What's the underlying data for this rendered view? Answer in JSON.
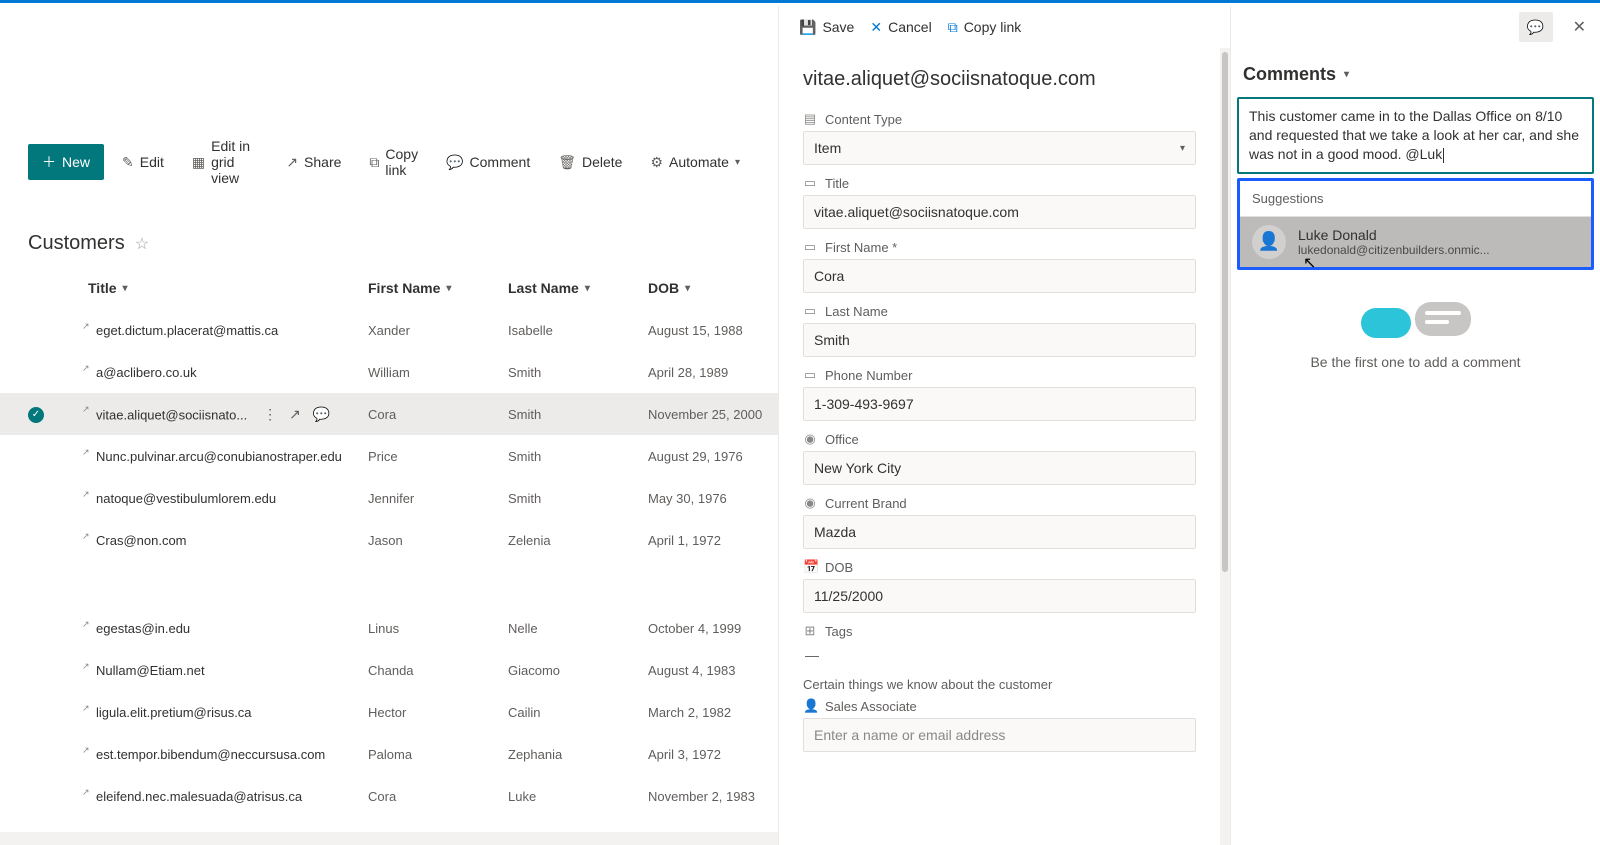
{
  "cmdbar": {
    "new_label": "New",
    "edit_label": "Edit",
    "edit_grid_label": "Edit in grid view",
    "share_label": "Share",
    "copy_link_label": "Copy link",
    "comment_label": "Comment",
    "delete_label": "Delete",
    "automate_label": "Automate"
  },
  "list": {
    "title": "Customers",
    "columns": {
      "title": "Title",
      "first_name": "First Name",
      "last_name": "Last Name",
      "dob": "DOB"
    }
  },
  "rows": [
    {
      "title": "eget.dictum.placerat@mattis.ca",
      "first": "Xander",
      "last": "Isabelle",
      "dob": "August 15, 1988"
    },
    {
      "title": "a@aclibero.co.uk",
      "first": "William",
      "last": "Smith",
      "dob": "April 28, 1989"
    },
    {
      "title": "vitae.aliquet@sociisnato...",
      "first": "Cora",
      "last": "Smith",
      "dob": "November 25, 2000",
      "selected": true
    },
    {
      "title": "Nunc.pulvinar.arcu@conubianostraper.edu",
      "first": "Price",
      "last": "Smith",
      "dob": "August 29, 1976"
    },
    {
      "title": "natoque@vestibulumlorem.edu",
      "first": "Jennifer",
      "last": "Smith",
      "dob": "May 30, 1976"
    },
    {
      "title": "Cras@non.com",
      "first": "Jason",
      "last": "Zelenia",
      "dob": "April 1, 1972"
    },
    {
      "title": "egestas@in.edu",
      "first": "Linus",
      "last": "Nelle",
      "dob": "October 4, 1999"
    },
    {
      "title": "Nullam@Etiam.net",
      "first": "Chanda",
      "last": "Giacomo",
      "dob": "August 4, 1983"
    },
    {
      "title": "ligula.elit.pretium@risus.ca",
      "first": "Hector",
      "last": "Cailin",
      "dob": "March 2, 1982"
    },
    {
      "title": "est.tempor.bibendum@neccursusa.com",
      "first": "Paloma",
      "last": "Zephania",
      "dob": "April 3, 1972"
    },
    {
      "title": "eleifend.nec.malesuada@atrisus.ca",
      "first": "Cora",
      "last": "Luke",
      "dob": "November 2, 1983"
    }
  ],
  "panel": {
    "save_label": "Save",
    "cancel_label": "Cancel",
    "copy_link_label": "Copy link",
    "item_title": "vitae.aliquet@sociisnatoque.com",
    "fields": {
      "content_type": {
        "label": "Content Type",
        "value": "Item"
      },
      "title": {
        "label": "Title",
        "value": "vitae.aliquet@sociisnatoque.com"
      },
      "first_name": {
        "label": "First Name *",
        "value": "Cora"
      },
      "last_name": {
        "label": "Last Name",
        "value": "Smith"
      },
      "phone": {
        "label": "Phone Number",
        "value": "1-309-493-9697"
      },
      "office": {
        "label": "Office",
        "value": "New York City"
      },
      "brand": {
        "label": "Current Brand",
        "value": "Mazda"
      },
      "dob": {
        "label": "DOB",
        "value": "11/25/2000"
      },
      "tags": {
        "label": "Tags",
        "value": "—"
      },
      "section_note": "Certain things we know about the customer",
      "sales_assoc": {
        "label": "Sales Associate",
        "placeholder": "Enter a name or email address"
      }
    }
  },
  "comments": {
    "header": "Comments",
    "editor_text": "This customer came in to the Dallas Office on 8/10 and requested that we take a look at her car, and she was not in a good mood. @Luk",
    "suggestions_label": "Suggestions",
    "suggestion": {
      "name": "Luke Donald",
      "email": "lukedonald@citizenbuilders.onmic..."
    },
    "empty_text": "Be the first one to add a comment"
  }
}
